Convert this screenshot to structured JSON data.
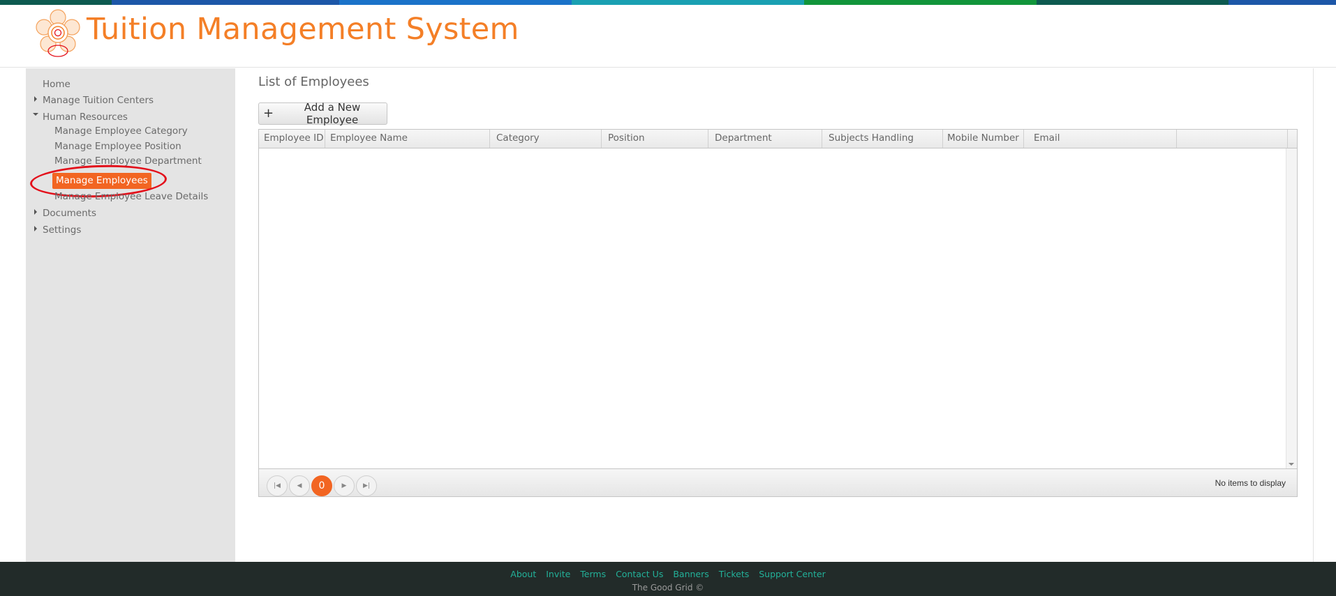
{
  "header": {
    "app_title": "Tuition Management System",
    "logo_icon": "flower-logo-icon",
    "stripe_colors": [
      "#0e5a50",
      "#1d57a8",
      "#1b73c9",
      "#1aa0b2",
      "#12953b",
      "#0e5a50",
      "#1d57a8"
    ]
  },
  "sidebar": {
    "items": [
      {
        "label": "Home"
      },
      {
        "label": "Manage Tuition Centers",
        "icon": "caret-right-icon"
      },
      {
        "label": "Human Resources",
        "icon": "caret-down-icon"
      },
      {
        "label": "Manage Employee Category"
      },
      {
        "label": "Manage Employee Position"
      },
      {
        "label": "Manage Employee Department"
      },
      {
        "label": "Manage Employees",
        "active": true
      },
      {
        "label": "Manage Employee Leave Details"
      },
      {
        "label": "Documents",
        "icon": "caret-right-icon"
      },
      {
        "label": "Settings",
        "icon": "caret-right-icon"
      }
    ]
  },
  "main": {
    "page_title": "List of Employees",
    "add_button_label": "Add a New Employee",
    "add_button_icon": "plus-icon",
    "grid": {
      "columns": [
        "Employee ID",
        "Employee Name",
        "Category",
        "Position",
        "Department",
        "Subjects Handling",
        "Mobile Number",
        "Email"
      ],
      "rows": []
    },
    "pager": {
      "current_page": "0",
      "info": "No items to display",
      "buttons": [
        "first-page-icon",
        "prev-page-icon",
        "next-page-icon",
        "last-page-icon"
      ]
    }
  },
  "footer": {
    "links": [
      "About",
      "Invite",
      "Terms",
      "Contact Us",
      "Banners",
      "Tickets",
      "Support Center"
    ],
    "copyright": "The Good Grid ©"
  },
  "colors": {
    "accent": "#f26522",
    "title": "#f47f27",
    "footer_bg": "#222b29",
    "footer_link": "#22b199"
  }
}
